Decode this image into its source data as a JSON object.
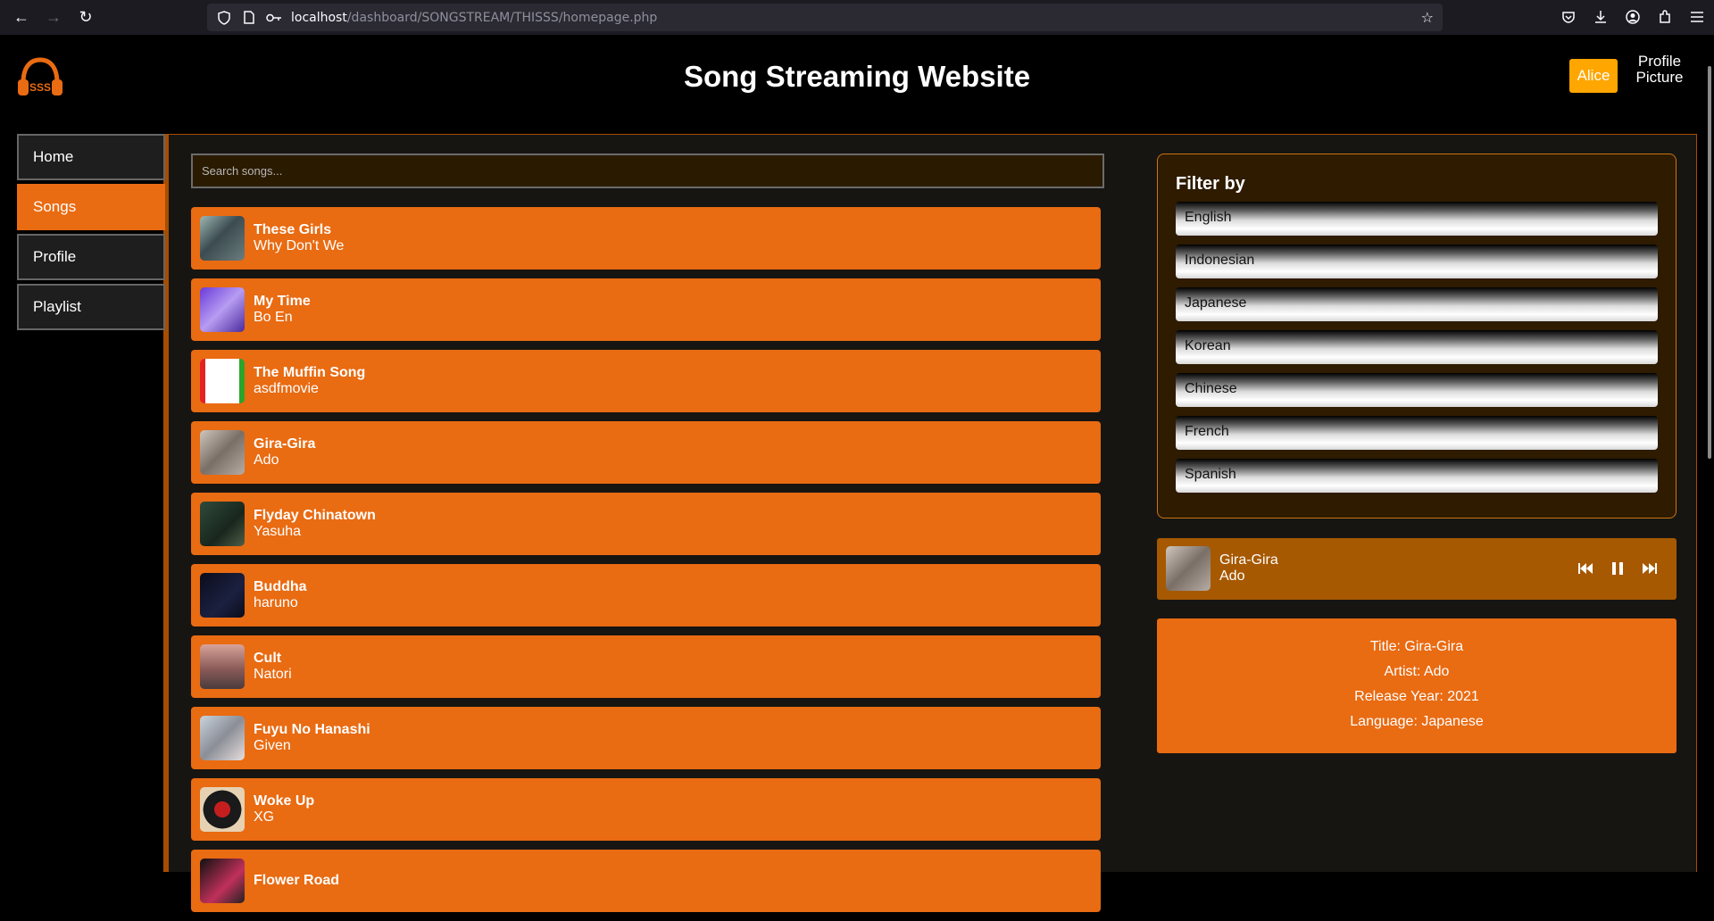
{
  "browser": {
    "url_host": "localhost",
    "url_path": "/dashboard/SONGSTREAM/THISSS/homepage.php"
  },
  "header": {
    "logo_text": "SSS",
    "title": "Song Streaming Website",
    "user_name": "Alice",
    "profile_picture_alt": "Profile Picture"
  },
  "sidebar": {
    "items": [
      {
        "label": "Home",
        "active": false
      },
      {
        "label": "Songs",
        "active": true
      },
      {
        "label": "Profile",
        "active": false
      },
      {
        "label": "Playlist",
        "active": false
      }
    ]
  },
  "search": {
    "placeholder": "Search songs..."
  },
  "songs": [
    {
      "title": "These Girls",
      "artist": "Why Don't We"
    },
    {
      "title": "My Time",
      "artist": "Bo En"
    },
    {
      "title": "The Muffin Song",
      "artist": "asdfmovie"
    },
    {
      "title": "Gira-Gira",
      "artist": "Ado"
    },
    {
      "title": "Flyday Chinatown",
      "artist": "Yasuha"
    },
    {
      "title": "Buddha",
      "artist": "haruno"
    },
    {
      "title": "Cult",
      "artist": "Natori"
    },
    {
      "title": "Fuyu No Hanashi",
      "artist": "Given"
    },
    {
      "title": "Woke Up",
      "artist": "XG"
    },
    {
      "title": "Flower Road",
      "artist": ""
    }
  ],
  "filter": {
    "title": "Filter by",
    "options": [
      "English",
      "Indonesian",
      "Japanese",
      "Korean",
      "Chinese",
      "French",
      "Spanish"
    ]
  },
  "player": {
    "title": "Gira-Gira",
    "artist": "Ado"
  },
  "details": {
    "title": "Title: Gira-Gira",
    "artist": "Artist: Ado",
    "year": "Release Year: 2021",
    "language": "Language: Japanese"
  },
  "colors": {
    "accent": "#e96b12",
    "dark_accent": "#a65900",
    "user_button": "#ffa600"
  }
}
